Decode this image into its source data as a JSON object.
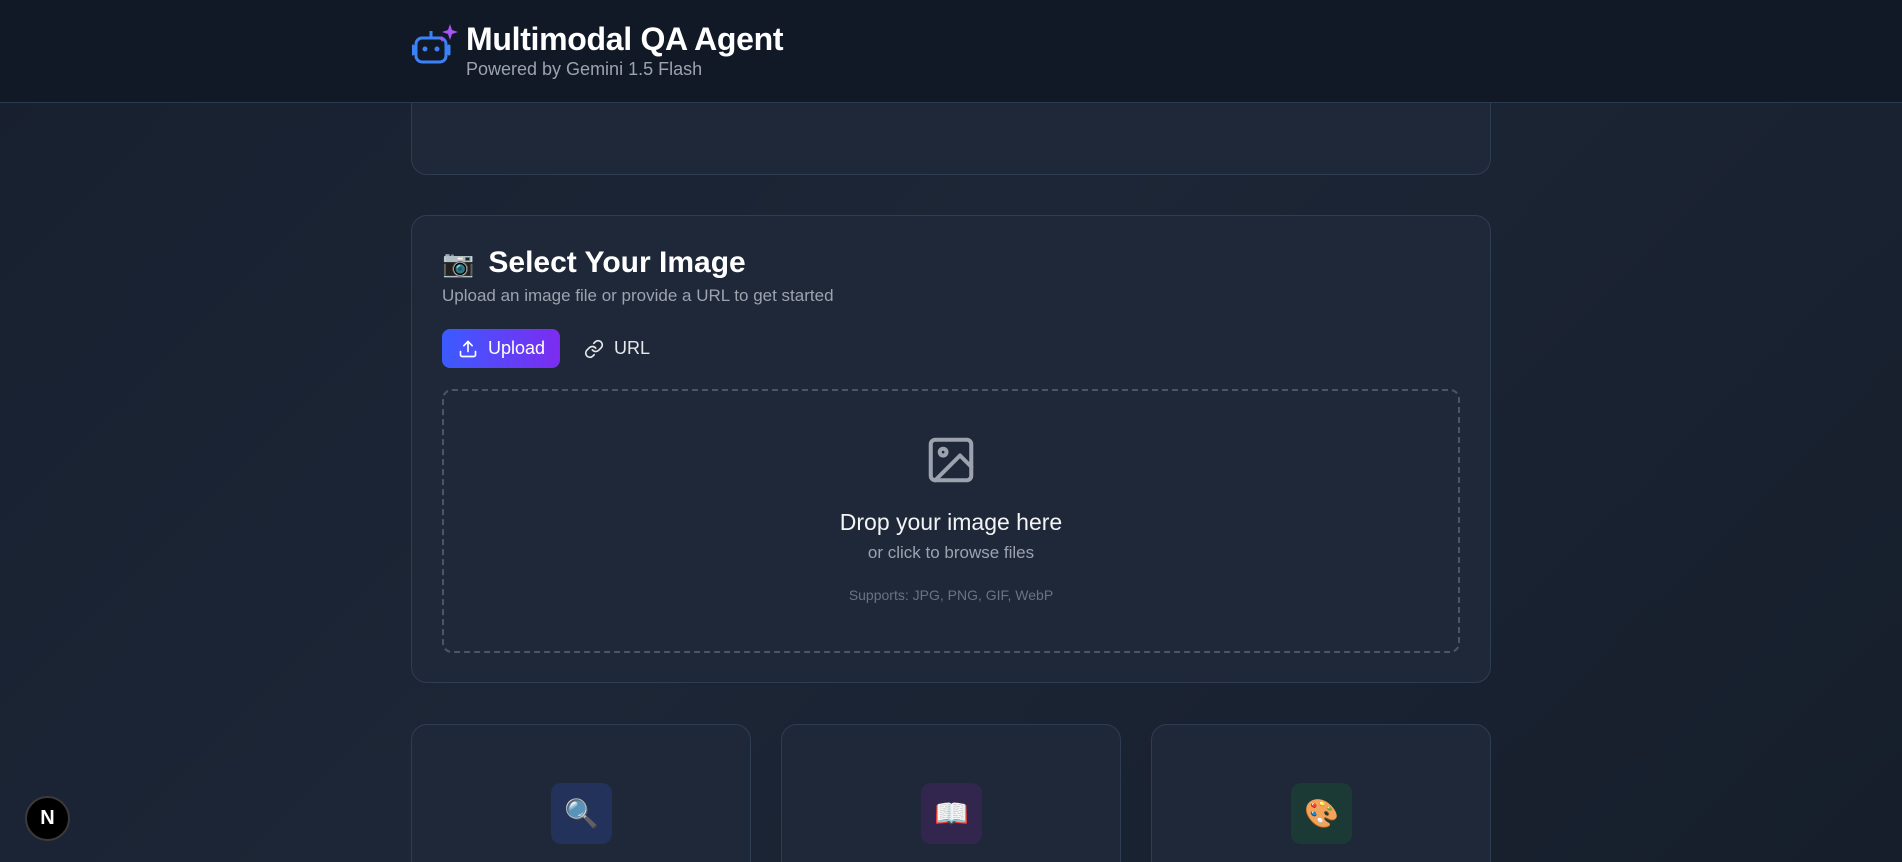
{
  "header": {
    "title": "Multimodal QA Agent",
    "subtitle": "Powered by Gemini 1.5 Flash",
    "logo_icon": "robot-sparkle-icon"
  },
  "image_section": {
    "icon": "📷",
    "title": "Select Your Image",
    "description": "Upload an image file or provide a URL to get started",
    "tabs": [
      {
        "label": "Upload",
        "icon": "upload-icon",
        "active": true
      },
      {
        "label": "URL",
        "icon": "link-icon",
        "active": false
      }
    ],
    "dropzone": {
      "icon": "image-icon",
      "title": "Drop your image here",
      "subtitle": "or click to browse files",
      "supports": "Supports: JPG, PNG, GIF, WebP"
    }
  },
  "features": [
    {
      "icon": "🔍",
      "icon_name": "magnifier-icon"
    },
    {
      "icon": "📖",
      "icon_name": "open-book-icon"
    },
    {
      "icon": "🎨",
      "icon_name": "palette-icon"
    }
  ],
  "dev_badge": {
    "label": "N"
  },
  "colors": {
    "background": "#1c2636",
    "header": "#111826",
    "card": "#1e2838",
    "accent_start": "#3b5bff",
    "accent_end": "#7c2cf0"
  }
}
